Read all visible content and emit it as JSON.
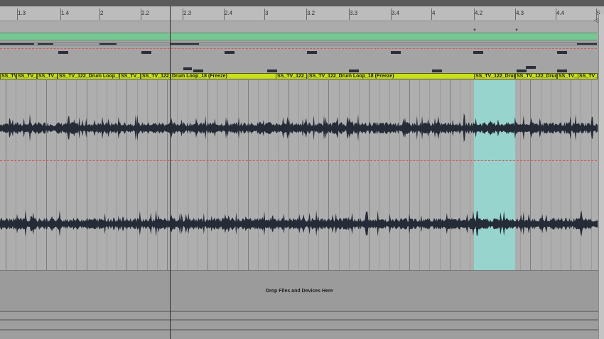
{
  "ruler": {
    "labels": [
      {
        "text": "1.3",
        "pos": 0.032
      },
      {
        "text": "1.4",
        "pos": 0.104
      },
      {
        "text": "2",
        "pos": 0.168
      },
      {
        "text": "2.2",
        "pos": 0.236
      },
      {
        "text": "2.3",
        "pos": 0.306
      },
      {
        "text": "2.4",
        "pos": 0.374
      },
      {
        "text": "3",
        "pos": 0.441
      },
      {
        "text": "3.2",
        "pos": 0.511
      },
      {
        "text": "3.3",
        "pos": 0.581
      },
      {
        "text": "3.4",
        "pos": 0.65
      },
      {
        "text": "4",
        "pos": 0.718
      },
      {
        "text": "4.2",
        "pos": 0.788
      },
      {
        "text": "4.3",
        "pos": 0.857
      },
      {
        "text": "4.4",
        "pos": 0.924
      },
      {
        "text": "5",
        "pos": 0.99
      }
    ]
  },
  "clips": [
    {
      "label": "SS_TV_1",
      "start": 0.0,
      "end": 0.027
    },
    {
      "label": "SS_TV_1",
      "start": 0.027,
      "end": 0.061
    },
    {
      "label": "SS_TV_1",
      "start": 0.061,
      "end": 0.095
    },
    {
      "label": "SS_TV_122_Drum Loop_18 (",
      "start": 0.095,
      "end": 0.198
    },
    {
      "label": "SS_TV_1",
      "start": 0.198,
      "end": 0.233
    },
    {
      "label": "SS_TV_122_",
      "start": 0.233,
      "end": 0.282
    },
    {
      "label": "Drum Loop_18 (Freeze)",
      "start": 0.282,
      "end": 0.457
    },
    {
      "label": "SS_TV_122_D",
      "start": 0.457,
      "end": 0.509
    },
    {
      "label": "SS_TV_122_Drum Loop_18 (Freeze)",
      "start": 0.509,
      "end": 0.785
    },
    {
      "label": "SS_TV_122_Drum",
      "start": 0.785,
      "end": 0.853
    },
    {
      "label": "SS_TV_122_Drum",
      "start": 0.853,
      "end": 0.922
    },
    {
      "label": "SS_TV_1",
      "start": 0.922,
      "end": 0.957
    },
    {
      "label": "SS_TV_1",
      "start": 0.957,
      "end": 0.99
    }
  ],
  "selection": {
    "start": 0.785,
    "end": 0.853
  },
  "drop_zone": {
    "text": "Drop Files and Devices Here"
  },
  "colors": {
    "clip_header": "#c9df1c",
    "loop_bar": "#77c793",
    "selection": "#97d4cd",
    "waveform": "#262b38",
    "lane_bg": "#aeaeae"
  }
}
